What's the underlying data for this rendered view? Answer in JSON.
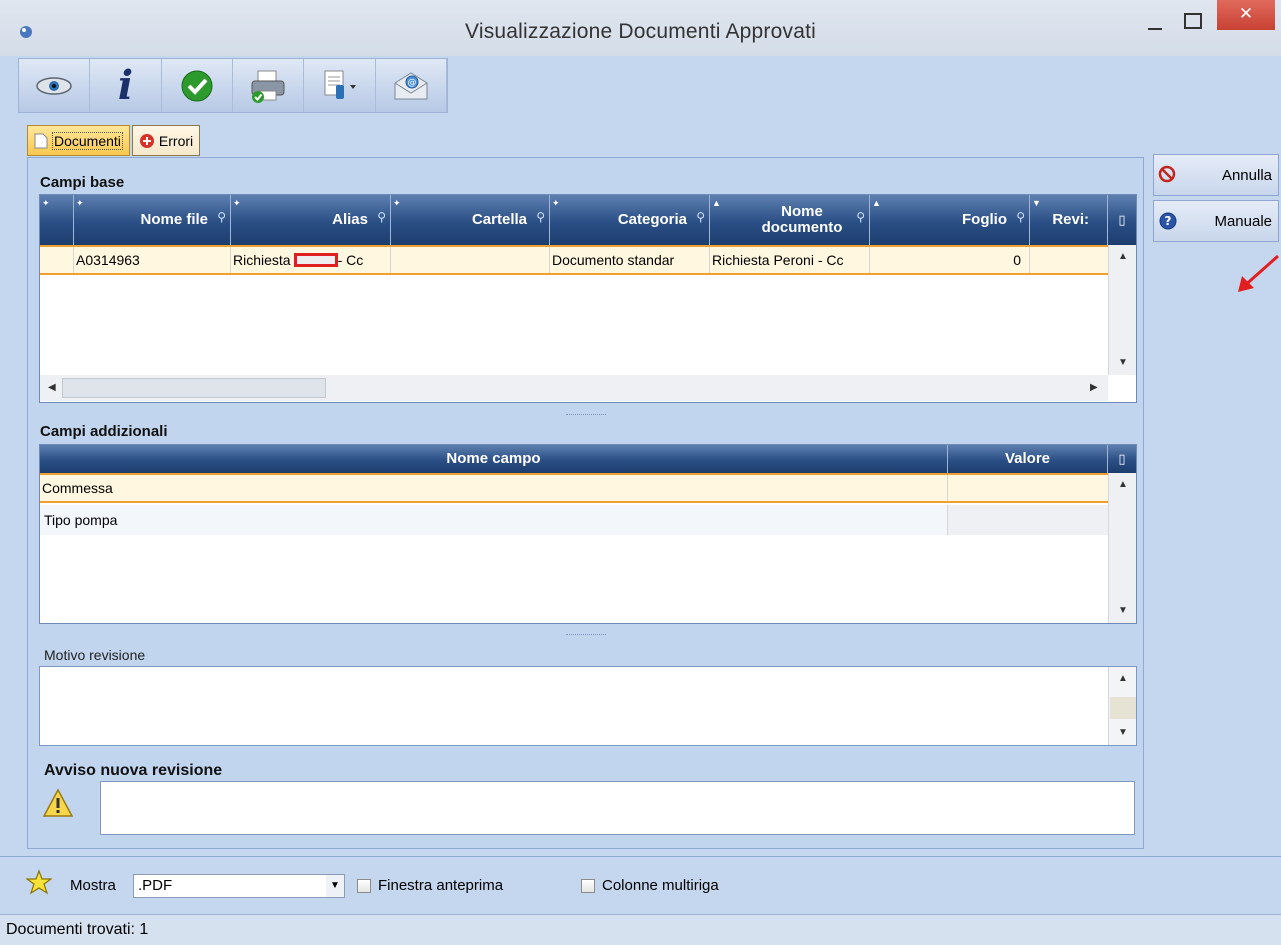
{
  "window": {
    "title": "Visualizzazione Documenti Approvati",
    "close_glyph": "✕",
    "min_glyph": "_",
    "max_glyph": "☐"
  },
  "toolbar": {
    "buttons": [
      {
        "icon": "eye-icon"
      },
      {
        "icon": "info-icon",
        "glyph": "i"
      },
      {
        "icon": "approve-check-icon"
      },
      {
        "icon": "printer-icon"
      },
      {
        "icon": "document-dropdown-icon"
      },
      {
        "icon": "email-icon"
      }
    ]
  },
  "tabs": [
    {
      "label": "Documenti",
      "active": true
    },
    {
      "label": "Errori",
      "active": false
    }
  ],
  "campi_base": {
    "title": "Campi base",
    "columns": [
      "Nome file",
      "Alias",
      "Cartella",
      "Categoria",
      "Nome documento",
      "Foglio",
      "Revi:"
    ],
    "rows": [
      {
        "nome_file": "A0314963",
        "alias_prefix": "Richiesta",
        "alias_suffix": " - Cc",
        "cartella": "",
        "categoria": "Documento standar",
        "nome_documento": "Richiesta Peroni - Cc",
        "foglio": "0",
        "revisione": ""
      }
    ]
  },
  "campi_addizionali": {
    "title": "Campi addizionali",
    "columns": [
      "Nome campo",
      "Valore"
    ],
    "rows": [
      {
        "nome": "Commessa",
        "valore": ""
      },
      {
        "nome": "Tipo pompa",
        "valore": ""
      }
    ]
  },
  "motivo_revisione": {
    "label": "Motivo revisione",
    "value": ""
  },
  "avviso": {
    "label": "Avviso nuova revisione",
    "value": ""
  },
  "side_buttons": {
    "annulla": "Annulla",
    "manuale": "Manuale"
  },
  "bottom": {
    "mostra_label": "Mostra",
    "mostra_value": ".PDF",
    "finestra_anteprima": "Finestra anteprima",
    "colonne_multiriga": "Colonne multiriga"
  },
  "status": {
    "text": "Documenti trovati: 1"
  },
  "colors": {
    "accent_orange": "#f0a030",
    "header_blue": "#2a4f85",
    "redaction_red": "#e02020",
    "annotation_arrow": "#e02020"
  }
}
